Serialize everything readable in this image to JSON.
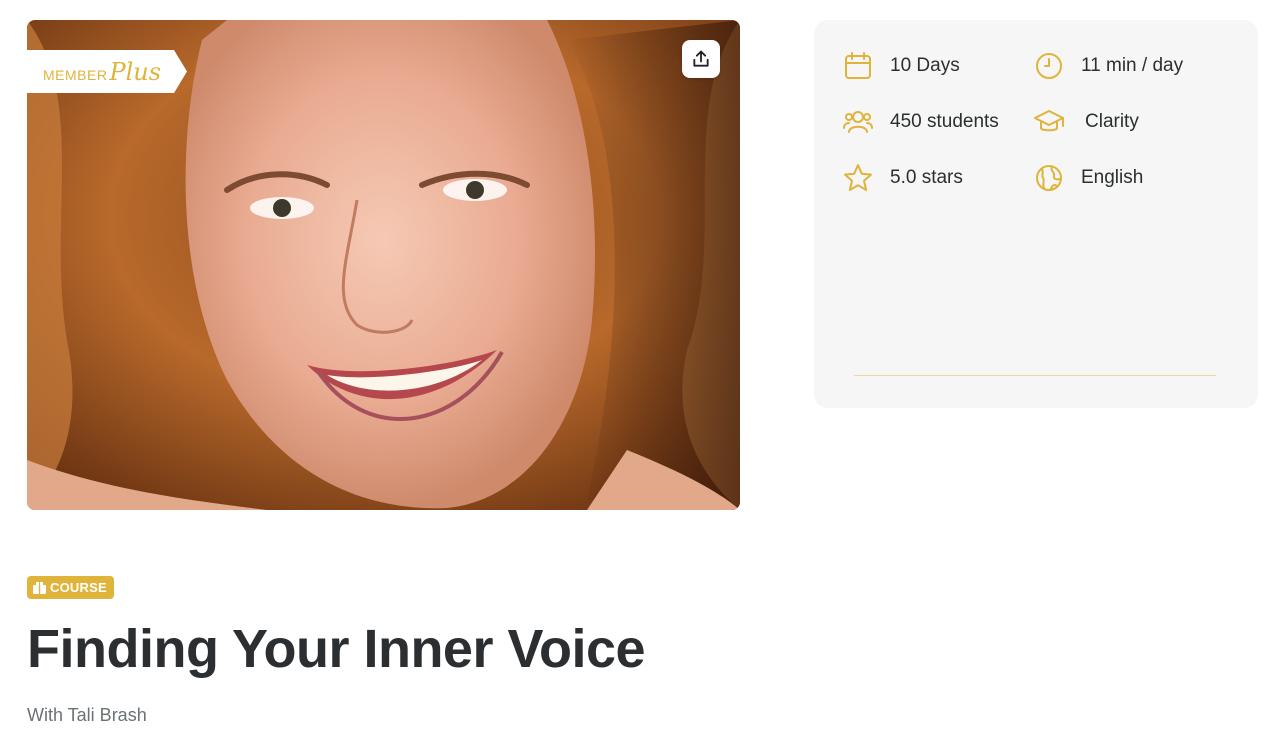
{
  "hero": {
    "badge": {
      "member_text": "MEMBER",
      "plus_text": "Plus"
    },
    "share_icon": "share-upload-icon"
  },
  "info": {
    "items": [
      {
        "icon": "calendar-icon",
        "label": "10 Days"
      },
      {
        "icon": "clock-icon",
        "label": "11 min / day"
      },
      {
        "icon": "students-icon",
        "label": "450 students"
      },
      {
        "icon": "graduation-cap-icon",
        "label": "Clarity"
      },
      {
        "icon": "star-icon",
        "label": "5.0 stars"
      },
      {
        "icon": "globe-icon",
        "label": "English"
      }
    ]
  },
  "course": {
    "tag": "COURSE",
    "title": "Finding Your Inner Voice",
    "author": "With Tali Brash"
  },
  "colors": {
    "accent": "#e0b33a",
    "card_bg": "#f5f6f5",
    "text": "#2b2f31",
    "muted": "#6b7275"
  }
}
